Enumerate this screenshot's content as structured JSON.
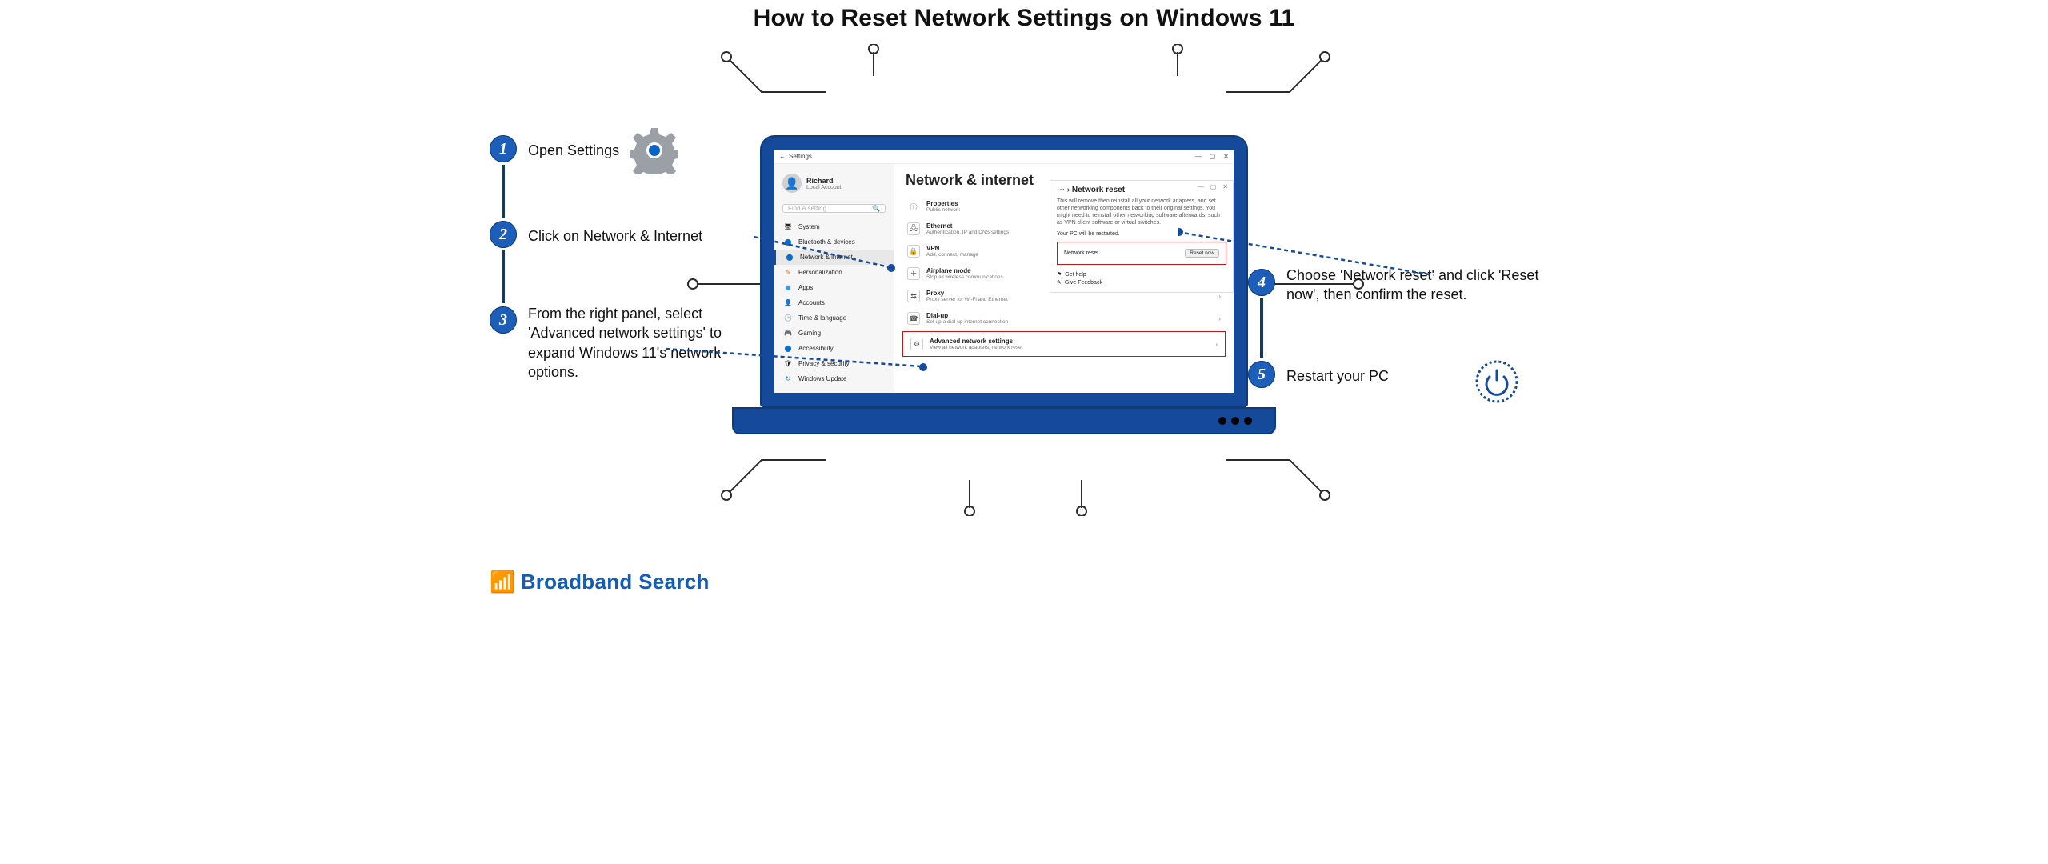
{
  "title": "How to Reset Network Settings on Windows 11",
  "brand": "Broadband Search",
  "steps": {
    "s1": {
      "num": "1",
      "text": "Open Settings"
    },
    "s2": {
      "num": "2",
      "text": "Click on Network & Internet"
    },
    "s3": {
      "num": "3",
      "text": "From the right panel, select 'Advanced network settings' to expand Windows 11's network options."
    },
    "s4": {
      "num": "4",
      "text": "Choose 'Network reset' and click 'Reset now', then confirm the reset."
    },
    "s5": {
      "num": "5",
      "text": "Restart your PC"
    }
  },
  "settings": {
    "windowTitle": "Settings",
    "sectionTitle": "Network & internet",
    "user": {
      "name": "Richard",
      "sub": "Local Account"
    },
    "search": {
      "placeholder": "Find a setting"
    },
    "nav": {
      "system": "System",
      "bluetooth": "Bluetooth & devices",
      "network": "Network & internet",
      "personalization": "Personalization",
      "apps": "Apps",
      "accounts": "Accounts",
      "time": "Time & language",
      "gaming": "Gaming",
      "accessibility": "Accessibility",
      "privacy": "Privacy & security",
      "update": "Windows Update"
    },
    "cards": {
      "properties": {
        "t": "Properties",
        "s": "Public network"
      },
      "ethernet": {
        "t": "Ethernet",
        "s": "Authentication, IP and DNS settings"
      },
      "vpn": {
        "t": "VPN",
        "s": "Add, connect, manage"
      },
      "airplane": {
        "t": "Airplane mode",
        "s": "Stop all wireless communications"
      },
      "proxy": {
        "t": "Proxy",
        "s": "Proxy server for Wi-Fi and Ethernet"
      },
      "dialup": {
        "t": "Dial-up",
        "s": "Set up a dial-up internet connection"
      },
      "advanced": {
        "t": "Advanced network settings",
        "s": "View all network adapters, network reset"
      }
    }
  },
  "reset": {
    "title": "Network reset",
    "desc": "This will remove then reinstall all your network adapters, and set other networking components back to their original settings. You might need to reinstall other networking software afterwards, such as VPN client software or virtual switches.",
    "note": "Your PC will be restarted.",
    "rowLabel": "Network reset",
    "buttonLabel": "Reset now",
    "help": "Get help",
    "feedback": "Give Feedback"
  }
}
